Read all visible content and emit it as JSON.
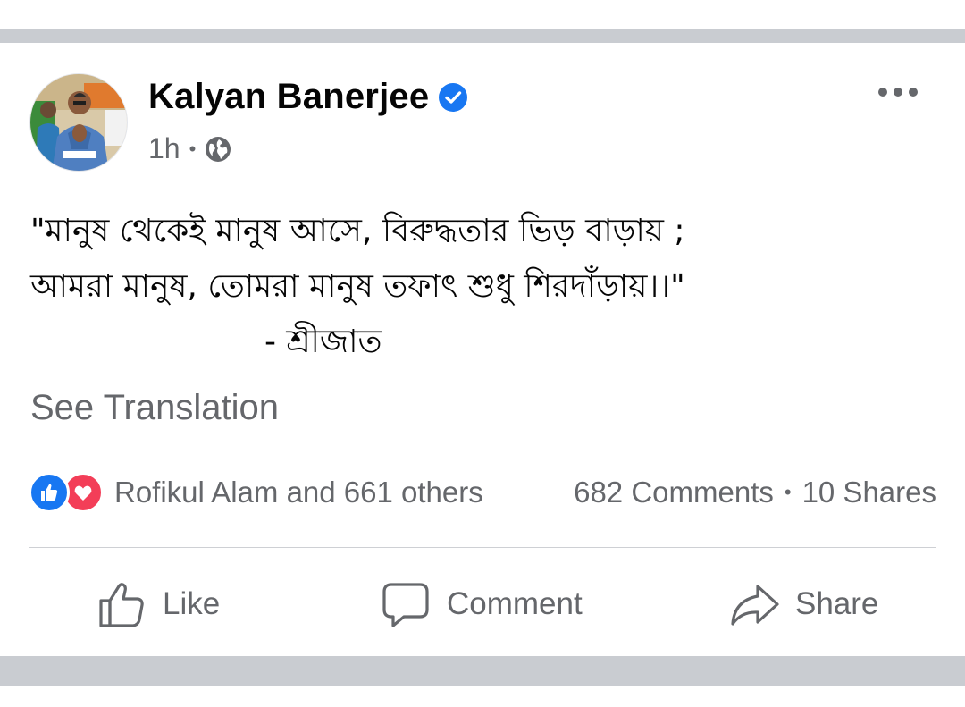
{
  "post": {
    "author": "Kalyan Banerjee",
    "time": "1h",
    "meta_separator": "•",
    "icons": {
      "verified": "verified-badge-icon",
      "audience": "globe-icon",
      "more": "more-options-icon"
    },
    "text_lines": [
      "\"মানুষ থেকেই মানুষ আসে, বিরুদ্ধতার ভিড় বাড়ায় ;",
      "আমরা মানুষ, তোমরা মানুষ তফাৎ শুধু শিরদাঁড়ায়।।\"",
      "- শ্রীজাত"
    ],
    "see_translation": "See Translation"
  },
  "engagement": {
    "reactors": "Rofikul Alam and 661 others",
    "comments": "682 Comments",
    "separator": "•",
    "shares": "10 Shares",
    "reaction_types": [
      "like",
      "love"
    ]
  },
  "actions": {
    "like": "Like",
    "comment": "Comment",
    "share": "Share"
  },
  "colors": {
    "brand_blue": "#1877f2",
    "love_red": "#f33e58",
    "secondary_text": "#65676b",
    "divider_band": "#c9ccd1"
  }
}
